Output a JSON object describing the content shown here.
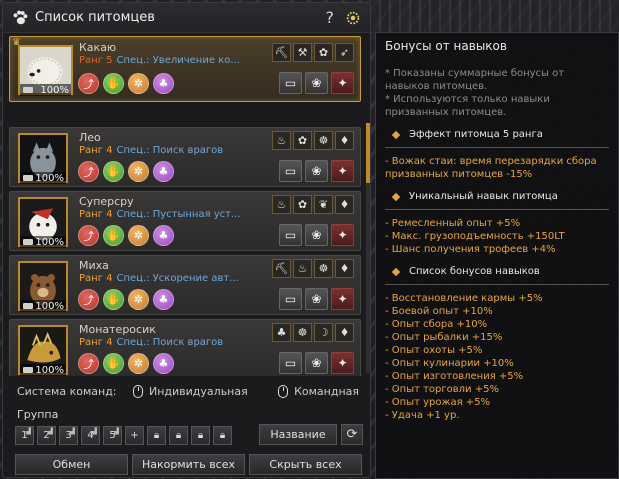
{
  "window": {
    "title": "Список питомцев",
    "help_label": "?"
  },
  "pets": [
    {
      "name": "Какаю",
      "rank": "Ранг 5",
      "spec": "Спец.: Увеличение ко...",
      "hp": "100%",
      "selected": true
    },
    {
      "name": "Лео",
      "rank": "Ранг 4",
      "spec": "Спец.: Поиск врагов",
      "hp": "100%",
      "selected": false
    },
    {
      "name": "Суперсру",
      "rank": "Ранг 4",
      "spec": "Спец.: Пустынная уст...",
      "hp": "100%",
      "selected": false
    },
    {
      "name": "Миха",
      "rank": "Ранг 4",
      "spec": "Спец.: Ускорение авт...",
      "hp": "100%",
      "selected": false
    },
    {
      "name": "Монатеросик",
      "rank": "Ранг 4",
      "spec": "Спец.: Поиск врагов",
      "hp": "100%",
      "selected": false
    }
  ],
  "command": {
    "label": "Система команд:",
    "individual": "Индивидуальная",
    "team": "Командная"
  },
  "group": {
    "label": "Группа",
    "slots": [
      "1",
      "2",
      "3",
      "4",
      "5"
    ],
    "add": "+",
    "sort_label": "Название"
  },
  "footer": {
    "exchange": "Обмен",
    "feed_all": "Накормить всех",
    "hide_all": "Скрыть всех"
  },
  "bonus_panel": {
    "title": "Бонусы от навыков",
    "notes": [
      "* Показаны суммарные бонусы от навыков питомцев.",
      "* Используются только навыки призванных питомцев."
    ],
    "rank_effect_head": "Эффект питомца 5 ранга",
    "rank_effect": [
      "- Вожак стаи: время перезарядки сбора призванных питомцев -15%"
    ],
    "unique_head": "Уникальный навык питомца",
    "unique": [
      "- Ремесленный опыт +5%",
      "- Макс. грузоподъемность +150LT",
      "- Шанс получения трофеев +4%"
    ],
    "list_head": "Список бонусов навыков",
    "list": [
      "- Восстановление кармы +5%",
      "- Боевой опыт +10%",
      "- Опыт сбора +10%",
      "- Опыт рыбалки +15%",
      "- Опыт охоты +5%",
      "- Опыт кулинарии +10%",
      "- Опыт изготовления +5%",
      "- Опыт торговли +5%",
      "- Опыт урожая +5%",
      "- Удача +1 ур."
    ]
  },
  "colors": {
    "rank_orange": "#e4a640",
    "spec_blue": "#6ea7d9",
    "selected_border": "#c79a3c"
  }
}
